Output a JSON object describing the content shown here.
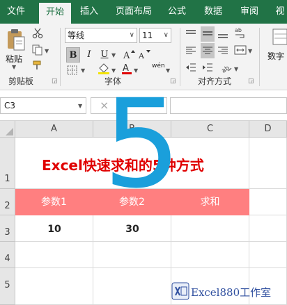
{
  "ribbon_tabs": [
    "文件",
    "开始",
    "插入",
    "页面布局",
    "公式",
    "数据",
    "审阅",
    "视"
  ],
  "active_tab": "开始",
  "clipboard": {
    "paste_label": "粘贴",
    "group_label": "剪贴板"
  },
  "font": {
    "name": "等线",
    "size": "11",
    "bold": "B",
    "italic": "I",
    "underline": "U",
    "phonetic": "wén",
    "group_label": "字体"
  },
  "alignment": {
    "group_label": "对齐方式"
  },
  "number": {
    "label": "数字"
  },
  "formula_bar": {
    "name_box": "C3",
    "cancel": "×"
  },
  "grid": {
    "columns": [
      "A",
      "B",
      "C",
      "D"
    ],
    "rows": [
      "1",
      "2",
      "3",
      "4",
      "5"
    ],
    "title": "Excel快速求和的5种方式",
    "headers": [
      "参数1",
      "参数2",
      "求和"
    ],
    "values": [
      "10",
      "30"
    ]
  },
  "overlay": {
    "big_number": "5"
  },
  "watermark": {
    "text": "Excel880工作室"
  },
  "colors": {
    "ribbon_green": "#217346",
    "title_red": "#e00000",
    "header_fill": "#ff7f80",
    "overlay_blue": "#1a9fdb"
  }
}
